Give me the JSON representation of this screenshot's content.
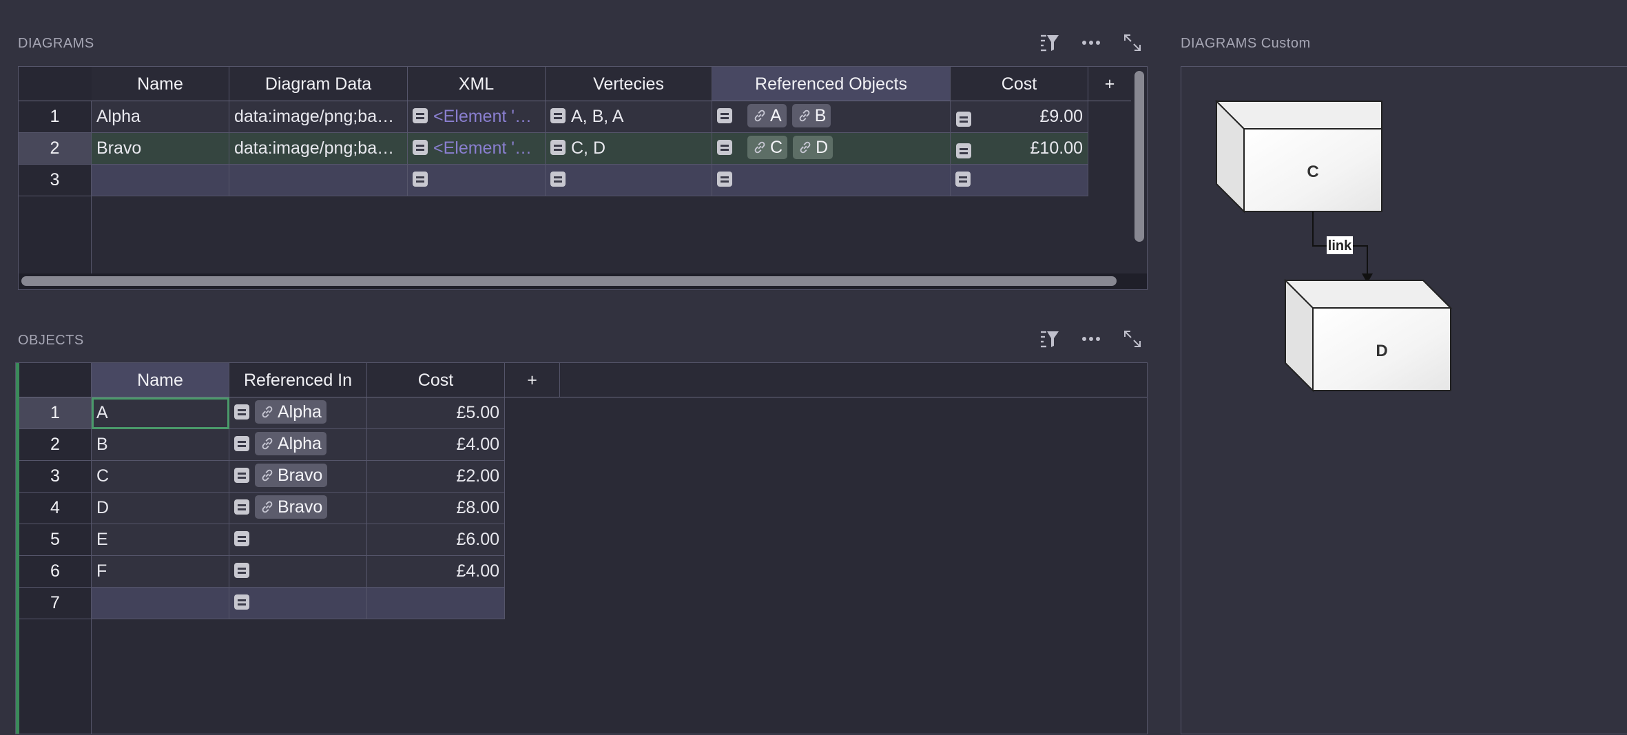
{
  "diagrams": {
    "title": "DIAGRAMS",
    "columns": [
      "Name",
      "Diagram Data",
      "XML",
      "Vertecies",
      "Referenced Objects",
      "Cost",
      "+"
    ],
    "rows": [
      {
        "num": "1",
        "name": "Alpha",
        "diagram_data": "data:image/png;ba…",
        "xml": "<Element '…",
        "vertecies": "A, B, A",
        "refs": [
          "A",
          "B"
        ],
        "cost": "£9.00"
      },
      {
        "num": "2",
        "name": "Bravo",
        "diagram_data": "data:image/png;ba…",
        "xml": "<Element '…",
        "vertecies": "C, D",
        "refs": [
          "C",
          "D"
        ],
        "cost": "£10.00"
      },
      {
        "num": "3",
        "name": "",
        "diagram_data": "",
        "xml": "",
        "vertecies": "",
        "refs": [],
        "cost": ""
      }
    ]
  },
  "objects": {
    "title": "OBJECTS",
    "columns": [
      "Name",
      "Referenced In",
      "Cost",
      "+"
    ],
    "rows": [
      {
        "num": "1",
        "name": "A",
        "ref": "Alpha",
        "cost": "£5.00"
      },
      {
        "num": "2",
        "name": "B",
        "ref": "Alpha",
        "cost": "£4.00"
      },
      {
        "num": "3",
        "name": "C",
        "ref": "Bravo",
        "cost": "£2.00"
      },
      {
        "num": "4",
        "name": "D",
        "ref": "Bravo",
        "cost": "£8.00"
      },
      {
        "num": "5",
        "name": "E",
        "ref": "",
        "cost": "£6.00"
      },
      {
        "num": "6",
        "name": "F",
        "ref": "",
        "cost": "£4.00"
      },
      {
        "num": "7",
        "name": "",
        "ref": "",
        "cost": ""
      }
    ]
  },
  "custom": {
    "title": "DIAGRAMS Custom",
    "node_c": "C",
    "node_d": "D",
    "edge_label": "link"
  },
  "icons": [
    "sort-filter-icon",
    "more-icon",
    "expand-icon",
    "list-icon",
    "link-icon"
  ],
  "colors": {
    "background": "#32323f",
    "selected_row": "#354540",
    "focus": "#4a9a6a"
  }
}
